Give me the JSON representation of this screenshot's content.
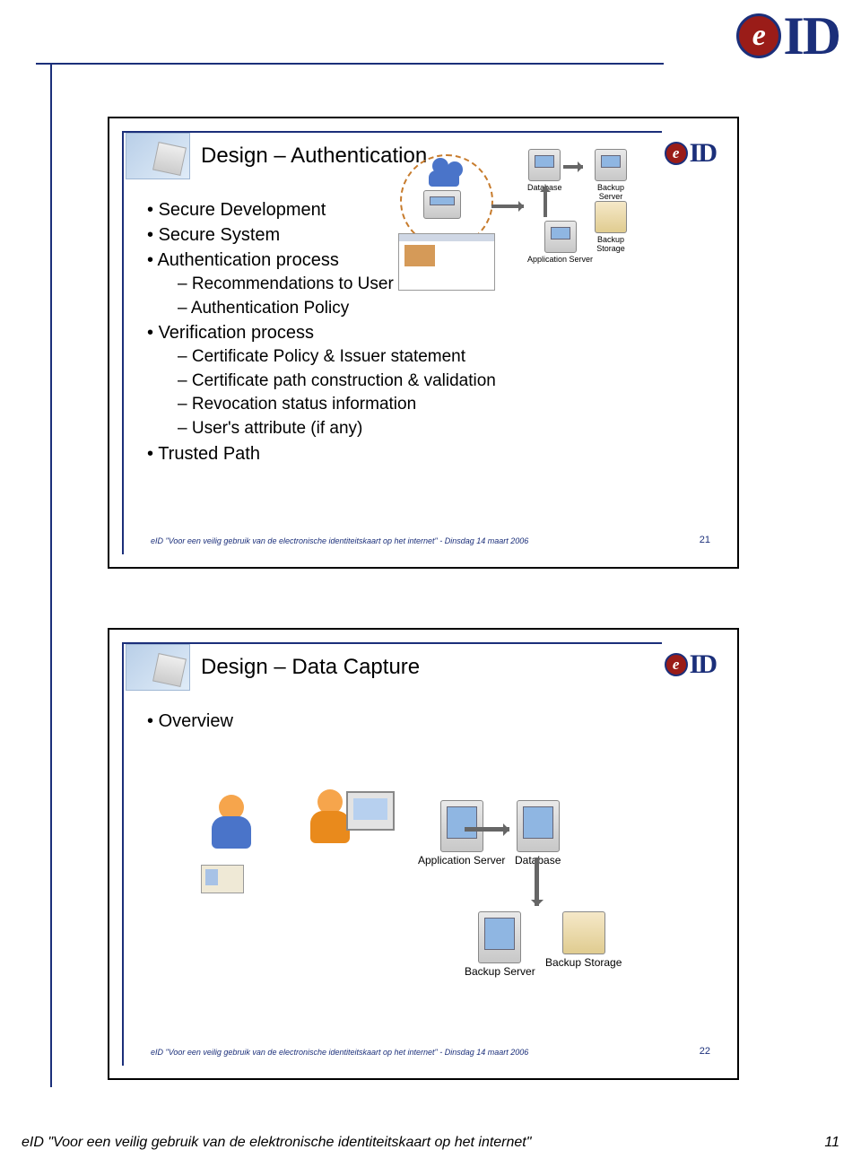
{
  "logo": {
    "brand": "eID"
  },
  "slide1": {
    "title": "Design – Authentication",
    "bullets": [
      {
        "level": 1,
        "text": "Secure Development"
      },
      {
        "level": 1,
        "text": "Secure System"
      },
      {
        "level": 1,
        "text": "Authentication process"
      },
      {
        "level": 2,
        "text": "Recommendations to User"
      },
      {
        "level": 2,
        "text": "Authentication Policy"
      },
      {
        "level": 1,
        "text": "Verification process"
      },
      {
        "level": 2,
        "text": "Certificate Policy & Issuer statement"
      },
      {
        "level": 2,
        "text": "Certificate path construction & validation"
      },
      {
        "level": 2,
        "text": "Revocation status information"
      },
      {
        "level": 2,
        "text": "User's attribute (if any)"
      },
      {
        "level": 1,
        "text": "Trusted Path"
      }
    ],
    "diagram": {
      "database": "Database",
      "backup_server": "Backup Server",
      "backup_storage": "Backup Storage",
      "app_server": "Application Server"
    },
    "footer": "eID \"Voor een veilig gebruik van de electronische identiteitskaart op het internet\" - Dinsdag 14 maart 2006",
    "number": "21"
  },
  "slide2": {
    "title": "Design – Data Capture",
    "bullets": [
      {
        "level": 1,
        "text": "Overview"
      }
    ],
    "diagram": {
      "app_server": "Application Server",
      "database": "Database",
      "backup_server": "Backup Server",
      "backup_storage": "Backup Storage"
    },
    "footer": "eID \"Voor een veilig gebruik van de electronische identiteitskaart op het internet\" - Dinsdag 14 maart 2006",
    "number": "22"
  },
  "page_footer": {
    "text": "eID \"Voor een veilig gebruik van de elektronische identiteitskaart op het internet\"",
    "page": "11"
  }
}
